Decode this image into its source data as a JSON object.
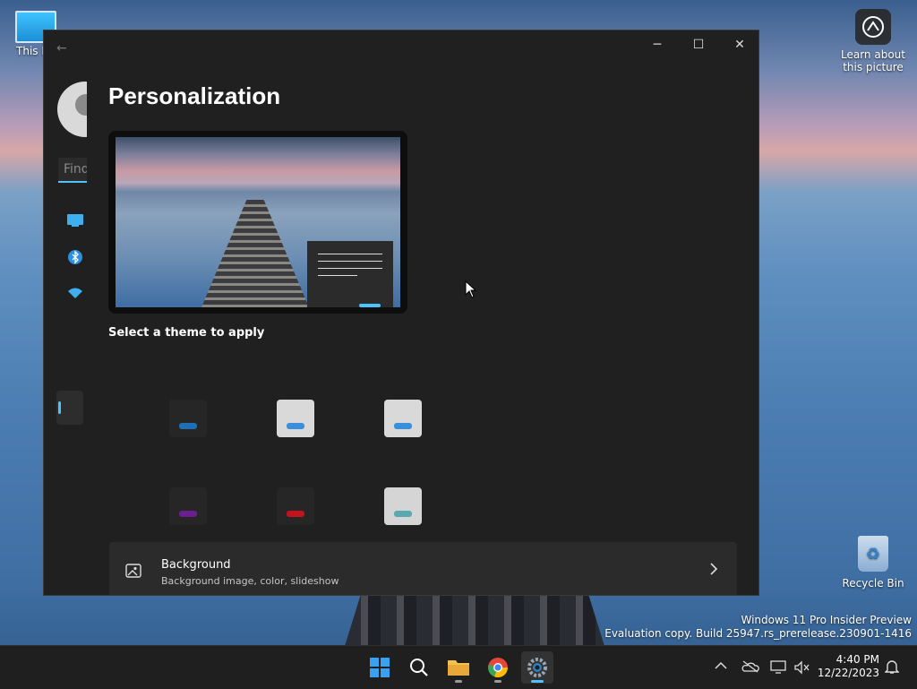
{
  "desktop": {
    "icons": [
      {
        "label": "This PC"
      },
      {
        "label": "Learn about this picture"
      },
      {
        "label": "Recycle Bin"
      }
    ],
    "watermark": {
      "line1": "Windows 11 Pro Insider Preview",
      "line2": "Evaluation copy. Build 25947.rs_prerelease.230901-1416"
    }
  },
  "window": {
    "controls": {
      "minimize": "─",
      "maximize": "☐",
      "close": "✕"
    },
    "back": "←",
    "search": {
      "placeholder": "Find"
    },
    "page_title": "Personalization",
    "select_theme_label": "Select a theme to apply",
    "themes": [
      {
        "name": "dark",
        "bg": "#262626",
        "accent": "#1f6fb5"
      },
      {
        "name": "light-blue",
        "bg": "#d9d9d9",
        "accent": "#3a8fdc"
      },
      {
        "name": "glow",
        "bg": "#d9d9d9",
        "accent": "#3a8fdc"
      },
      {
        "name": "purple",
        "bg": "#262626",
        "accent": "#6a1f8f"
      },
      {
        "name": "red",
        "bg": "#262626",
        "accent": "#c3141e"
      },
      {
        "name": "teal",
        "bg": "#d5d5d5",
        "accent": "#5aa8b0"
      }
    ],
    "background_row": {
      "title": "Background",
      "description": "Background image, color, slideshow"
    }
  },
  "taskbar": {
    "apps": [
      "start-icon",
      "search-icon",
      "file-explorer-icon",
      "chrome-icon",
      "settings-icon"
    ],
    "time": "4:40 PM",
    "date": "12/22/2023"
  },
  "colors": {
    "accent": "#4cc2ff",
    "window_bg": "#202020",
    "card_bg": "#2b2b2b"
  }
}
